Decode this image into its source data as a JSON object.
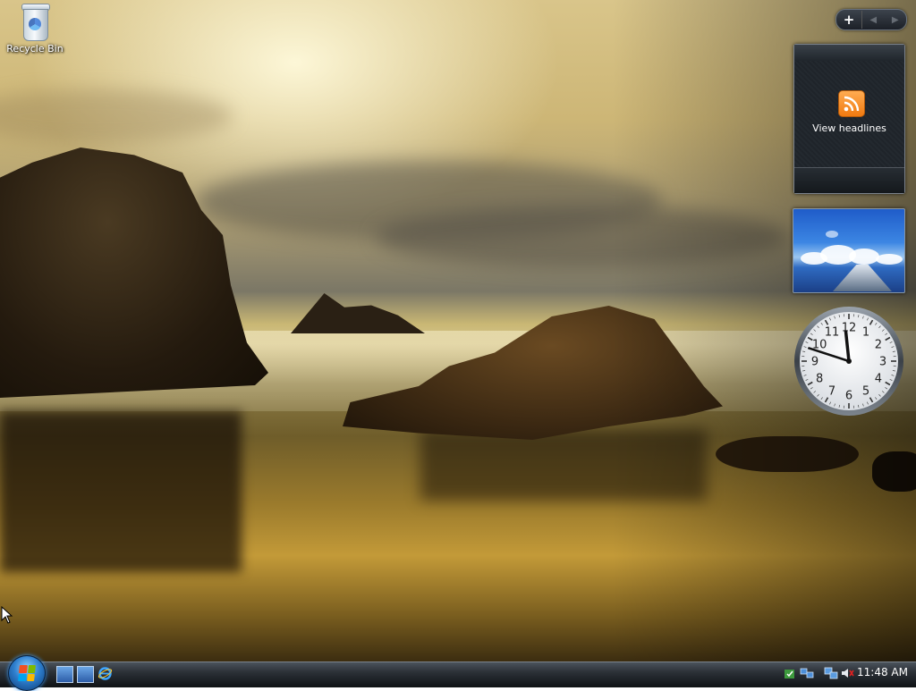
{
  "desktop": {
    "icons": [
      {
        "label": "Recycle Bin",
        "icon": "recycle-bin-icon"
      }
    ]
  },
  "sidebar": {
    "add_gadget": "+",
    "gadgets": {
      "feed_headlines": {
        "label": "View headlines",
        "icon": "rss-feed-icon"
      },
      "slideshow": {
        "icon": "slideshow-image"
      },
      "clock": {
        "hour": 11,
        "minute": 48,
        "numerals": [
          "12",
          "1",
          "2",
          "3",
          "4",
          "5",
          "6",
          "7",
          "8",
          "9",
          "10",
          "11"
        ]
      }
    }
  },
  "taskbar": {
    "start_icon": "windows-start-orb",
    "quick_launch": [
      "show-desktop-icon",
      "switch-windows-icon",
      "internet-explorer-icon"
    ],
    "tray_icons": [
      "windows-update-icon",
      "network-icon",
      "network-connection-icon",
      "volume-muted-icon"
    ],
    "clock": "11:48 AM"
  },
  "colors": {
    "rss_orange": "#f58a1f",
    "taskbar_dark": "#1a1e23",
    "start_orb_blue": "#2e7fce"
  }
}
